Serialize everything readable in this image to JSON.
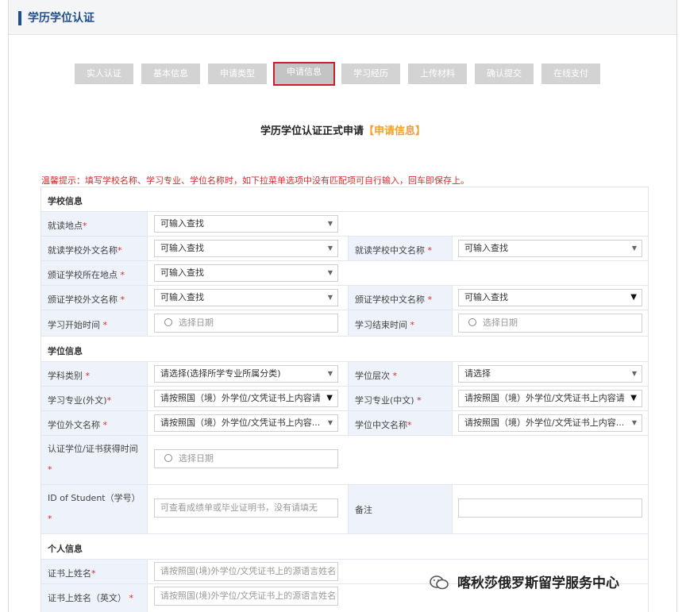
{
  "header": {
    "title": "学历学位认证"
  },
  "steps": [
    {
      "label": "实人认证"
    },
    {
      "label": "基本信息"
    },
    {
      "label": "申请类型"
    },
    {
      "label": "申请信息"
    },
    {
      "label": "学习经历"
    },
    {
      "label": "上传材料"
    },
    {
      "label": "确认提交"
    },
    {
      "label": "在线支付"
    }
  ],
  "form": {
    "heading": "学历学位认证正式申请",
    "heading_tag": "【申请信息】",
    "tip": "温馨提示：填写学校名称、学习专业、学位名称时，如下拉菜单选项中没有匹配项可自行输入，回车即保存上。"
  },
  "sections": {
    "school": "学校信息",
    "degree": "学位信息",
    "personal": "个人信息"
  },
  "fields": {
    "study_location": {
      "label": "就读地点",
      "star": "*",
      "value": "可输入查找"
    },
    "school_foreign": {
      "label": "就读学校外文名称",
      "star": "*",
      "value": "可输入查找"
    },
    "school_cn": {
      "label": "就读学校中文名称",
      "star": " *",
      "value": "可输入查找"
    },
    "issuer_location": {
      "label": "颁证学校所在地点",
      "star": " *",
      "value": "可输入查找"
    },
    "issuer_foreign": {
      "label": "颁证学校外文名称",
      "star": " *",
      "value": "可输入查找"
    },
    "issuer_cn": {
      "label": "颁证学校中文名称",
      "star": " *",
      "value": "可输入查找"
    },
    "start_date": {
      "label": "学习开始时间",
      "star": " *",
      "value": "选择日期"
    },
    "end_date": {
      "label": "学习结束时间",
      "star": " *",
      "value": "选择日期"
    },
    "subject": {
      "label": "学科类别",
      "star": " *",
      "value": "请选择(选择所学专业所属分类)"
    },
    "degree_level": {
      "label": "学位层次",
      "star": " *",
      "value": "请选择"
    },
    "major_foreign": {
      "label": "学习专业(外文)",
      "star": "*",
      "value": "请按照国（境）外学位/文凭证书上内容请"
    },
    "major_cn": {
      "label": "学习专业(中文)",
      "star": " *",
      "value": "请按照国（境）外学位/文凭证书上内容请"
    },
    "degree_foreign": {
      "label": "学位外文名称",
      "star": " *",
      "value": "请按照国（境）外学位/文凭证书上内容..."
    },
    "degree_cn": {
      "label": "学位中文名称",
      "star": "*",
      "value": "请按照国（境）外学位/文凭证书上内容..."
    },
    "award_time": {
      "label": "认证学位/证书获得时间",
      "star": "*",
      "value": "选择日期"
    },
    "student_id": {
      "label": "ID of Student（学号）",
      "star": "*",
      "placeholder": "可查看成绩单或毕业证明书，没有请填无"
    },
    "remark": {
      "label": "备注",
      "value": ""
    },
    "cert_name": {
      "label": "证书上姓名",
      "star": "*",
      "placeholder": "请按照国(境)外学位/文凭证书上的源语言姓名"
    },
    "cert_name_en": {
      "label": "证书上姓名（英文）",
      "star": " *",
      "placeholder": "请按照国(境)外学位/文凭证书上的源语言姓名"
    }
  },
  "watermark": {
    "text": "喀秋莎俄罗斯留学服务中心"
  },
  "colors": {
    "accent": "#f0a030",
    "required": "#d62b2b",
    "active_step_border": "#c8202a",
    "label_bg": "#eef2fa",
    "brand": "#1f4e8c"
  }
}
